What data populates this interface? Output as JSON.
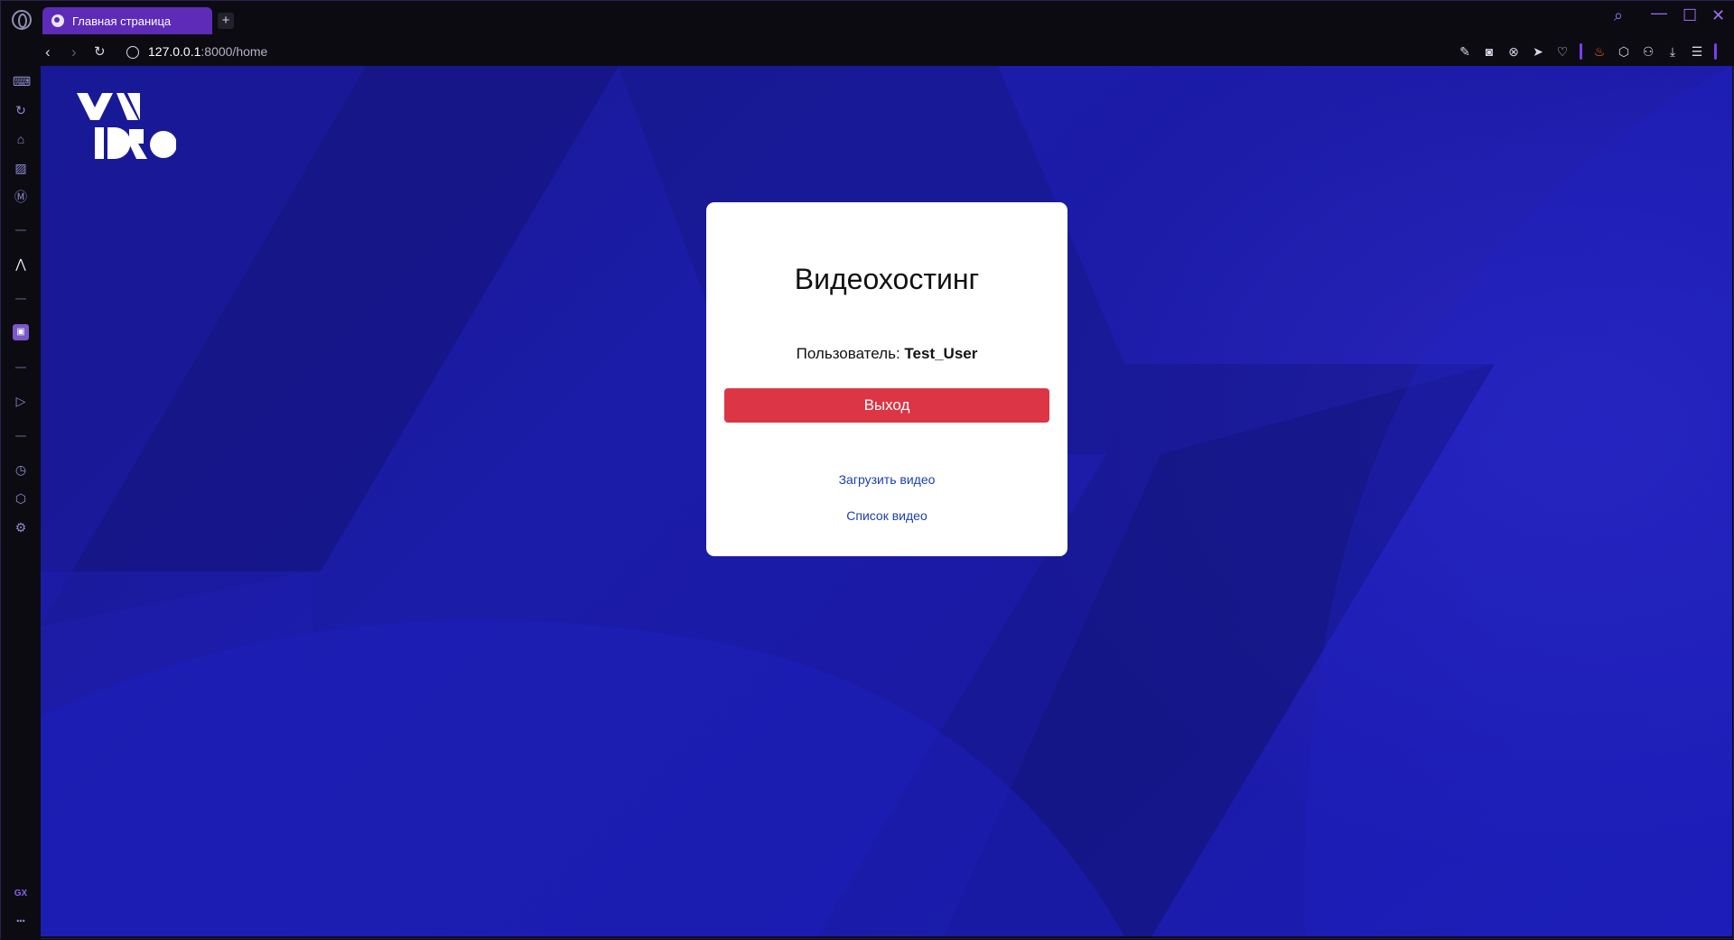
{
  "browser": {
    "tab_title": "Главная страница",
    "new_tab_symbol": "+",
    "url_host": "127.0.0.1",
    "url_rest": ":8000/home",
    "window_controls": [
      "search-icon",
      "minimize-icon",
      "maximize-icon",
      "close-icon"
    ],
    "toolbar_icons": [
      "edit-icon",
      "camera-icon",
      "block-icon",
      "send-icon",
      "heart-icon",
      "fire-icon",
      "cube-icon",
      "profile-icon",
      "download-icon",
      "menu-icon"
    ],
    "sidebar_icons": [
      "gaming-icon",
      "refresh-icon",
      "cleaner-icon",
      "display-icon",
      "mod-icon",
      "aria-icon",
      "twitch-icon",
      "player-icon",
      "history-icon",
      "extensions-icon",
      "settings-icon"
    ],
    "sidebar_footer": "GX",
    "sidebar_more": "•••"
  },
  "page": {
    "title": "Видеохостинг",
    "user_label": "Пользователь:",
    "username": "Test_User",
    "logout_button": "Выход",
    "upload_link": "Загрузить видео",
    "list_link": "Список видео"
  },
  "colors": {
    "accent": "#7b3df0",
    "tab_active": "#5d2bb8",
    "logout": "#dc3545",
    "link": "#1a3fb0",
    "background": "#1b1ca8"
  }
}
